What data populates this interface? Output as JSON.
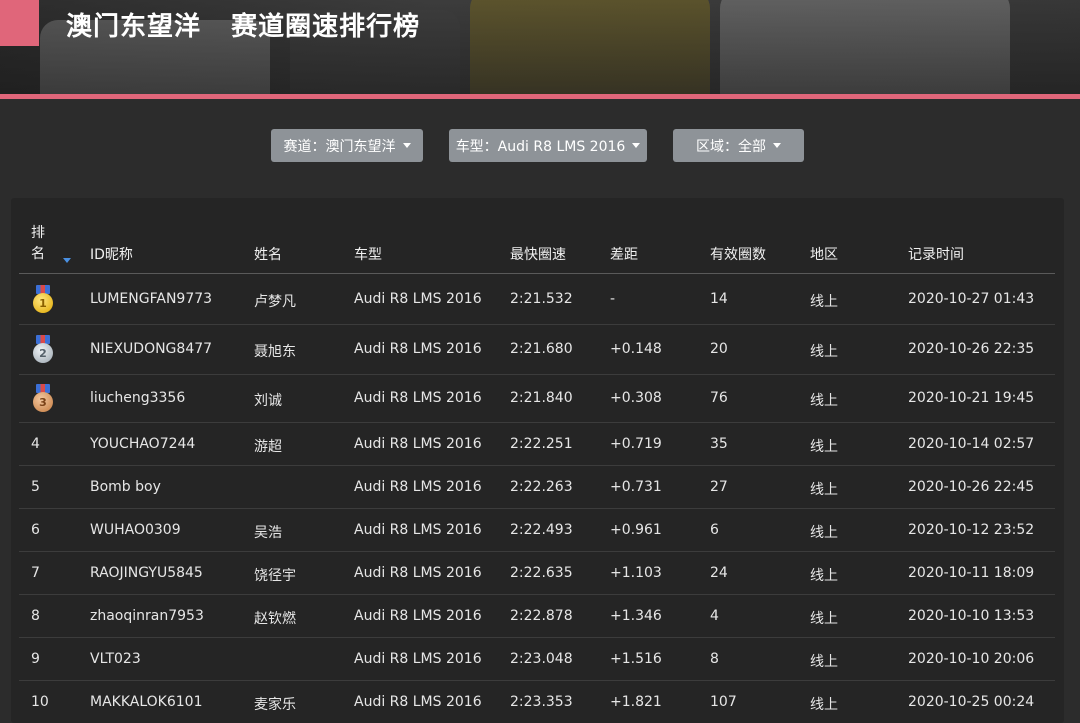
{
  "header": {
    "title": "澳门东望洋   赛道圈速排行榜"
  },
  "filters": {
    "track_label": "赛道：澳门东望洋",
    "car_label": "车型：Audi R8 LMS 2016",
    "region_label": "区域：全部"
  },
  "columns": {
    "rank": "排名",
    "id": "ID昵称",
    "name": "姓名",
    "car": "车型",
    "best": "最快圈速",
    "gap": "差距",
    "laps": "有效圈数",
    "region": "地区",
    "time": "记录时间"
  },
  "rows": [
    {
      "rank": "1",
      "medal": "gold",
      "id": "LUMENGFAN9773",
      "name": "卢梦凡",
      "car": "Audi R8 LMS 2016",
      "best": "2:21.532",
      "gap": "-",
      "laps": "14",
      "region": "线上",
      "time": "2020-10-27 01:43"
    },
    {
      "rank": "2",
      "medal": "silver",
      "id": "NIEXUDONG8477",
      "name": "聂旭东",
      "car": "Audi R8 LMS 2016",
      "best": "2:21.680",
      "gap": "+0.148",
      "laps": "20",
      "region": "线上",
      "time": "2020-10-26 22:35"
    },
    {
      "rank": "3",
      "medal": "bronze",
      "id": "liucheng3356",
      "name": "刘诚",
      "car": "Audi R8 LMS 2016",
      "best": "2:21.840",
      "gap": "+0.308",
      "laps": "76",
      "region": "线上",
      "time": "2020-10-21 19:45"
    },
    {
      "rank": "4",
      "medal": "",
      "id": "YOUCHAO7244",
      "name": "游超",
      "car": "Audi R8 LMS 2016",
      "best": "2:22.251",
      "gap": "+0.719",
      "laps": "35",
      "region": "线上",
      "time": "2020-10-14 02:57"
    },
    {
      "rank": "5",
      "medal": "",
      "id": "Bomb boy",
      "name": "",
      "car": "Audi R8 LMS 2016",
      "best": "2:22.263",
      "gap": "+0.731",
      "laps": "27",
      "region": "线上",
      "time": "2020-10-26 22:45"
    },
    {
      "rank": "6",
      "medal": "",
      "id": "WUHAO0309",
      "name": "吴浩",
      "car": "Audi R8 LMS 2016",
      "best": "2:22.493",
      "gap": "+0.961",
      "laps": "6",
      "region": "线上",
      "time": "2020-10-12 23:52"
    },
    {
      "rank": "7",
      "medal": "",
      "id": "RAOJINGYU5845",
      "name": "饶径宇",
      "car": "Audi R8 LMS 2016",
      "best": "2:22.635",
      "gap": "+1.103",
      "laps": "24",
      "region": "线上",
      "time": "2020-10-11 18:09"
    },
    {
      "rank": "8",
      "medal": "",
      "id": "zhaoqinran7953",
      "name": "赵钦燃",
      "car": "Audi R8 LMS 2016",
      "best": "2:22.878",
      "gap": "+1.346",
      "laps": "4",
      "region": "线上",
      "time": "2020-10-10 13:53"
    },
    {
      "rank": "9",
      "medal": "",
      "id": "VLT023",
      "name": "",
      "car": "Audi R8 LMS 2016",
      "best": "2:23.048",
      "gap": "+1.516",
      "laps": "8",
      "region": "线上",
      "time": "2020-10-10 20:06"
    },
    {
      "rank": "10",
      "medal": "",
      "id": "MAKKALOK6101",
      "name": "麦家乐",
      "car": "Audi R8 LMS 2016",
      "best": "2:23.353",
      "gap": "+1.821",
      "laps": "107",
      "region": "线上",
      "time": "2020-10-25 00:24"
    }
  ],
  "colors": {
    "accent": "#e0667a",
    "sort": "#4a90e2",
    "filter_bg": "#8e9398"
  }
}
